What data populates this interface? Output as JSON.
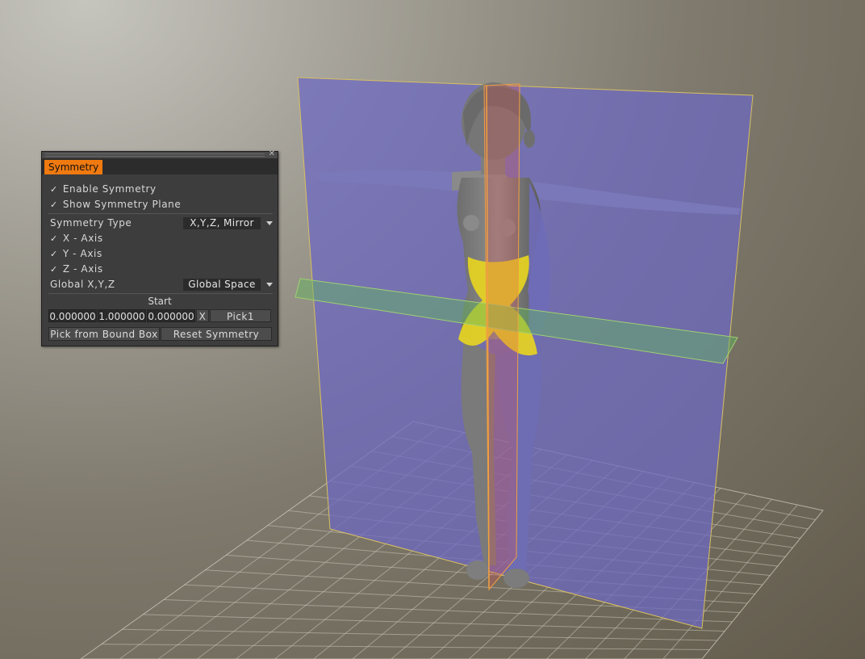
{
  "panel": {
    "tab_label": "Symmetry",
    "enable_symmetry": {
      "checked": true,
      "label": "Enable Symmetry"
    },
    "show_plane": {
      "checked": true,
      "label": "Show Symmetry Plane"
    },
    "symmetry_type_label": "Symmetry Type",
    "symmetry_type_value": "X,Y,Z, Mirror",
    "axes": [
      {
        "checked": true,
        "label": "X - Axis"
      },
      {
        "checked": true,
        "label": "Y - Axis"
      },
      {
        "checked": true,
        "label": "Z - Axis"
      }
    ],
    "global_label": "Global X,Y,Z",
    "global_value": "Global Space",
    "start_label": "Start",
    "start_x": "0.000000",
    "start_y": "1.000000",
    "start_z": "0.000000",
    "x_button": "X",
    "pick_button": "Pick1",
    "pick_bound_button": "Pick from Bound Box",
    "reset_button": "Reset Symmetry"
  },
  "colors": {
    "tab_accent": "#f07a10",
    "plane_x": "#7c76c8",
    "plane_y": "#5fb45a",
    "plane_z": "#e05050",
    "mask": "#e6d422"
  },
  "icons": {
    "check": "checkmark-icon",
    "dropdown": "dropdown-arrow-icon",
    "close": "close-icon"
  }
}
